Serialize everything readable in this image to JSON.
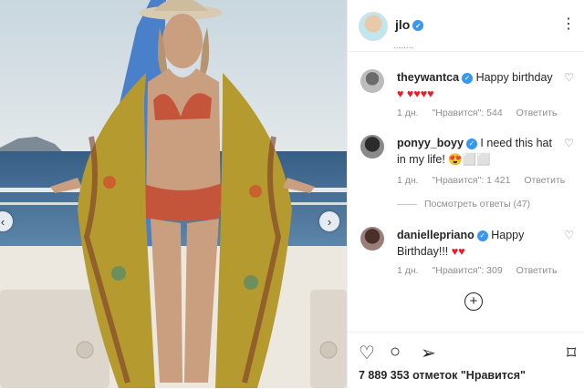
{
  "post": {
    "username": "jlo",
    "scroll_hint": "........",
    "like_count_text": "7 889 353 отметок \"Нравится\""
  },
  "comments": [
    {
      "username": "theywantca",
      "text": "Happy birthday",
      "emoji_tail": "♥ ♥♥♥♥",
      "age": "1 дн.",
      "likes": "\"Нравится\": 544",
      "reply": "Ответить"
    },
    {
      "username": "ponyy_boyy",
      "text": "I need this hat in my life!",
      "emoji_tail": "😍⬜⬜",
      "age": "1 дн.",
      "likes": "\"Нравится\": 1 421",
      "reply": "Ответить",
      "view_replies": "Посмотреть ответы (47)"
    },
    {
      "username": "daniellepriano",
      "text": "Happy Birthday!!!",
      "emoji_tail": "♥♥",
      "age": "1 дн.",
      "likes": "\"Нравится\": 309",
      "reply": "Ответить"
    }
  ],
  "icons": {
    "verified": "✓",
    "more": "⋮",
    "like": "♡",
    "comment": "○",
    "share": "➢",
    "save": "⌑",
    "add": "+",
    "prev": "‹",
    "next": "›"
  },
  "colors": {
    "verified": "#3897f0",
    "heart": "#ed1c24"
  }
}
